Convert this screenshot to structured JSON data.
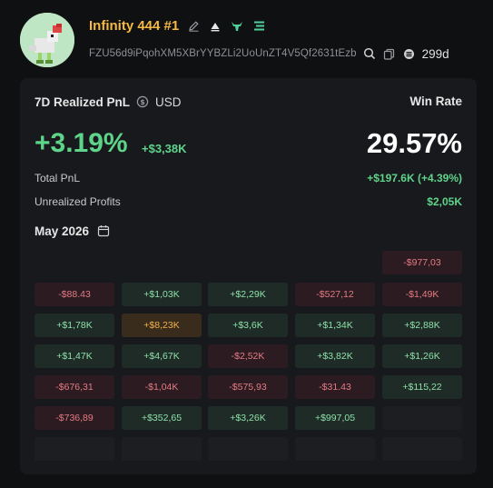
{
  "profile": {
    "name": "Infinity 444 #1",
    "address": "FZU56d9iPqohXM5XBrYYBZLi2UoUnZT4V5Qf2631tEzb",
    "age": "299d"
  },
  "colors": {
    "positive": "#5ed38a",
    "negative": "#e57b85",
    "accent": "#f5b944"
  },
  "summary": {
    "title": "7D Realized PnL",
    "currency": "USD",
    "pnl_percent": "+3.19%",
    "pnl_abs": "+$3,38K",
    "winrate_label": "Win Rate",
    "winrate_value": "29.57%",
    "total_pnl_label": "Total PnL",
    "total_pnl_value": "+$197.6K (+4.39%)",
    "unrealized_label": "Unrealized Profits",
    "unrealized_value": "$2,05K"
  },
  "calendar": {
    "month": "May 2026",
    "rows": [
      [
        {
          "t": "",
          "k": "none"
        },
        {
          "t": "",
          "k": "none"
        },
        {
          "t": "",
          "k": "none"
        },
        {
          "t": "",
          "k": "none"
        },
        {
          "t": "-$977,03",
          "k": "neg"
        }
      ],
      [
        {
          "t": "-$88.43",
          "k": "neg"
        },
        {
          "t": "+$1,03K",
          "k": "pos"
        },
        {
          "t": "+$2,29K",
          "k": "pos"
        },
        {
          "t": "-$527,12",
          "k": "neg"
        },
        {
          "t": "-$1,49K",
          "k": "neg"
        }
      ],
      [
        {
          "t": "+$1,78K",
          "k": "pos"
        },
        {
          "t": "+$8,23K",
          "k": "hi"
        },
        {
          "t": "+$3,6K",
          "k": "pos"
        },
        {
          "t": "+$1,34K",
          "k": "pos"
        },
        {
          "t": "+$2,88K",
          "k": "pos"
        }
      ],
      [
        {
          "t": "+$1,47K",
          "k": "pos"
        },
        {
          "t": "+$4,67K",
          "k": "pos"
        },
        {
          "t": "-$2,52K",
          "k": "neg"
        },
        {
          "t": "+$3,82K",
          "k": "pos"
        },
        {
          "t": "+$1,26K",
          "k": "pos"
        }
      ],
      [
        {
          "t": "-$676,31",
          "k": "neg"
        },
        {
          "t": "-$1,04K",
          "k": "neg"
        },
        {
          "t": "-$575,93",
          "k": "neg"
        },
        {
          "t": "-$31.43",
          "k": "neg"
        },
        {
          "t": "+$115,22",
          "k": "pos"
        }
      ],
      [
        {
          "t": "-$736,89",
          "k": "neg"
        },
        {
          "t": "+$352,65",
          "k": "pos"
        },
        {
          "t": "+$3,26K",
          "k": "pos"
        },
        {
          "t": "+$997,05",
          "k": "pos"
        },
        {
          "t": "",
          "k": "empty"
        }
      ],
      [
        {
          "t": "",
          "k": "empty"
        },
        {
          "t": "",
          "k": "empty"
        },
        {
          "t": "",
          "k": "empty"
        },
        {
          "t": "",
          "k": "empty"
        },
        {
          "t": "",
          "k": "empty"
        }
      ]
    ]
  }
}
